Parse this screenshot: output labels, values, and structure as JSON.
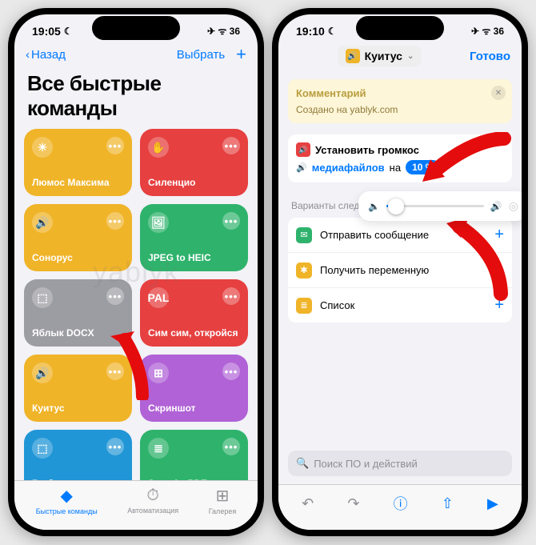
{
  "left": {
    "status": {
      "time": "19:05",
      "icons": "✈ ᯤ 36"
    },
    "nav": {
      "back": "Назад",
      "select": "Выбрать"
    },
    "title": "Все быстрые команды",
    "cards": [
      {
        "label": "Люмос Максима",
        "color": "#f0b429",
        "icon": "☀"
      },
      {
        "label": "Силенцио",
        "color": "#e64040",
        "icon": "✋"
      },
      {
        "label": "Сонорус",
        "color": "#f0b429",
        "icon": "🔊"
      },
      {
        "label": "JPEG to HEIC",
        "color": "#2fb36c",
        "icon": "🖼"
      },
      {
        "label": "Яблык DOCX",
        "color": "#9c9ca3",
        "icon": "⬚"
      },
      {
        "label": "Сим сим, откройся",
        "color": "#e64040",
        "icon": "PAL"
      },
      {
        "label": "Куитус",
        "color": "#f0b429",
        "icon": "🔊"
      },
      {
        "label": "Скриншот",
        "color": "#b062d6",
        "icon": "⊞"
      },
      {
        "label": "Выбрать из меню",
        "color": "#2196d6",
        "icon": "⬚"
      },
      {
        "label": "Save As PDF",
        "color": "#2fb36c",
        "icon": "≣"
      }
    ],
    "tabs": [
      {
        "label": "Быстрые команды",
        "icon": "◆",
        "active": true
      },
      {
        "label": "Автоматизация",
        "icon": "⏱",
        "active": false
      },
      {
        "label": "Галерея",
        "icon": "⊞",
        "active": false
      }
    ]
  },
  "right": {
    "status": {
      "time": "19:10",
      "icons": "✈ ᯤ 36"
    },
    "nav": {
      "title": "Куитус",
      "done": "Готово"
    },
    "comment": {
      "header": "Комментарий",
      "text": "Создано на yablyk.com"
    },
    "action": {
      "verb": "Установить громкос",
      "media_label": "медиафайлов",
      "na": "на",
      "value": "10 %"
    },
    "slider_value": 10,
    "section": "Варианты следующего дейст",
    "options": [
      {
        "label": "Отправить сообщение",
        "color": "#2fb36c",
        "icon": "✉"
      },
      {
        "label": "Получить переменную",
        "color": "#f0b429",
        "icon": "✱"
      },
      {
        "label": "Список",
        "color": "#f0b429",
        "icon": "≣"
      }
    ],
    "search_placeholder": "Поиск ПО и действий"
  },
  "watermark": "yablyk"
}
